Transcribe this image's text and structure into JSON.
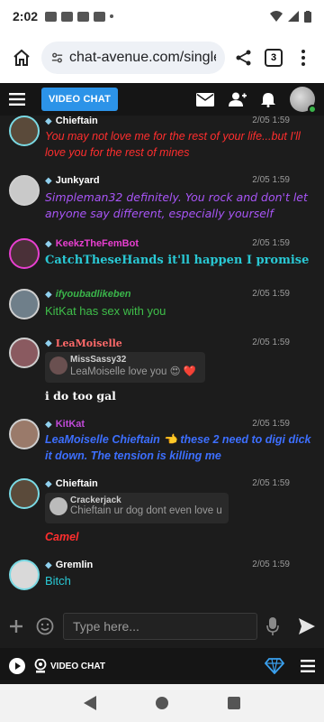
{
  "status": {
    "time": "2:02"
  },
  "browser": {
    "url": "chat-avenue.com/single:",
    "tab_count": "3"
  },
  "header": {
    "video_chat_label": "VIDEO CHAT"
  },
  "messages": [
    {
      "user": "Chieftain",
      "user_color": "#ffffff",
      "time": "2/05 1:59",
      "text": "You may not love me for the rest of your life...but I'll love you for the rest of mines",
      "text_color": "#ff2e2e",
      "avatar_color": "#5a4a3a"
    },
    {
      "user": "Junkyard",
      "user_color": "#ffffff",
      "time": "2/05 1:59",
      "text": "Simpleman32 definitely. You rock and don't let anyone say different, especially yourself",
      "text_color": "#a855f7",
      "avatar_color": "#c9c9c9"
    },
    {
      "user": "KeekzTheFemBot",
      "user_color": "#e83fd0",
      "time": "2/05 1:59",
      "text": "CatchTheseHands it'll happen I promise",
      "text_color": "#29c8d4",
      "avatar_color": "#4a3038"
    },
    {
      "user": "ifyoubadlikeben",
      "user_color": "#3ab54a",
      "time": "2/05 1:59",
      "text": "KitKat has sex with you",
      "text_color": "#3fbf4a",
      "avatar_color": "#6f7f8a"
    },
    {
      "user": "LeaMoiselle",
      "user_color": "#ff6a6a",
      "time": "2/05 1:59",
      "quote_user": "MissSassy32",
      "quote_text": "LeaMoiselle love you 😍 ❤️",
      "text": "i do too gal",
      "text_color": "#ffffff",
      "avatar_color": "#8a5a60"
    },
    {
      "user": "KitKat",
      "user_color": "#c14ad9",
      "time": "2/05 1:59",
      "text": "LeaMoiselle Chieftain 👈 these 2 need to digi dick it down. The tension is killing me",
      "text_color": "#3d6fff",
      "avatar_color": "#9a7a6a"
    },
    {
      "user": "Chieftain",
      "user_color": "#ffffff",
      "time": "2/05 1:59",
      "quote_user": "Crackerjack",
      "quote_text": "Chieftain ur dog dont even love u",
      "text": "Camel",
      "text_color": "#ff2e2e",
      "avatar_color": "#5a4a3a"
    },
    {
      "user": "Gremlin",
      "user_color": "#ffffff",
      "time": "2/05 1:59",
      "text": "Bitch",
      "text_color": "#29c8d4",
      "avatar_color": "#d9d9d9"
    }
  ],
  "input": {
    "placeholder": "Type here..."
  },
  "footer": {
    "video_chat_label": "VIDEO CHAT"
  },
  "colors": {
    "accent": "#2c93e8",
    "chat_bg": "#1c1c1c",
    "header_bg": "#151515"
  }
}
